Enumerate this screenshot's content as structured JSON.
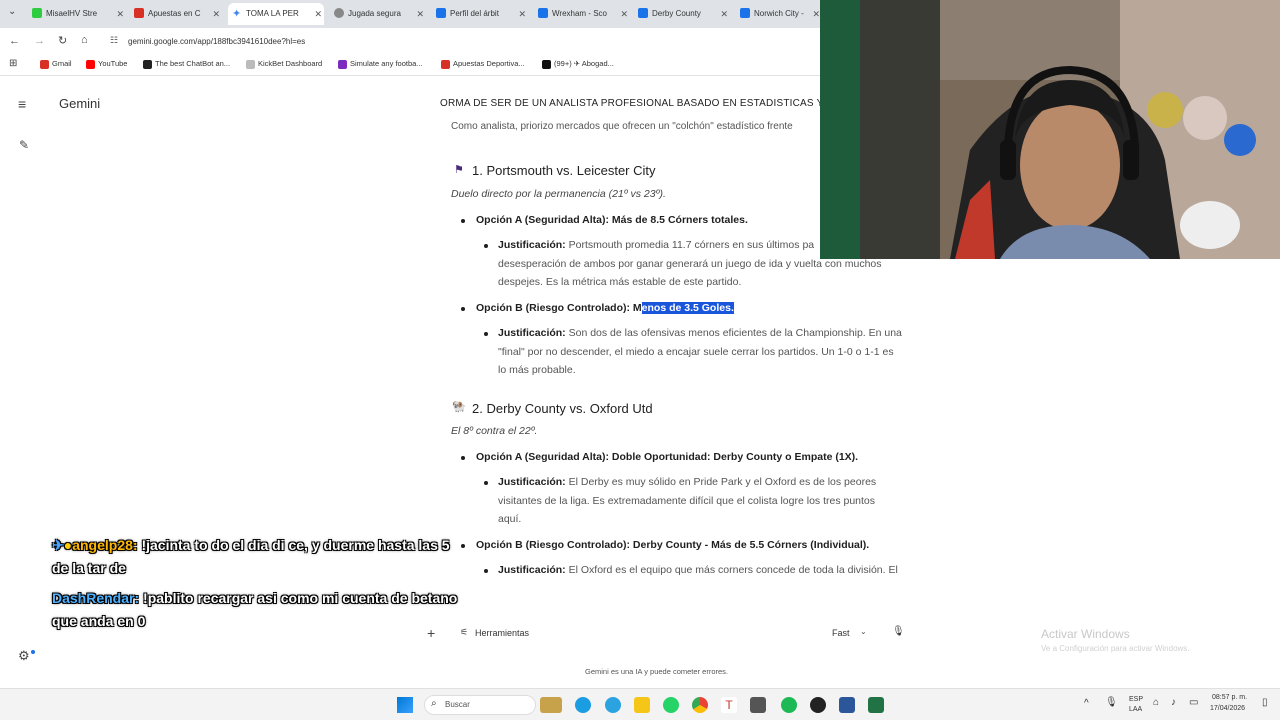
{
  "tabs": [
    {
      "label": "MisaelHV Stre",
      "color": "#2ecc40"
    },
    {
      "label": "Apuestas en C",
      "color": "#d93025"
    },
    {
      "label": "TOMA LA PER",
      "color": "#4285f4"
    },
    {
      "label": "Jugada segura",
      "color": "#777"
    },
    {
      "label": "Perfil del árbit",
      "color": "#1a73e8"
    },
    {
      "label": "Wrexham - Sco",
      "color": "#1a73e8"
    },
    {
      "label": "Derby County",
      "color": "#1a73e8"
    },
    {
      "label": "Norwich City -",
      "color": "#1a73e8"
    }
  ],
  "address": "gemini.google.com/app/188fbc3941610dee?hl=es",
  "bookmarks": [
    {
      "label": "Gmail",
      "color": "#d93025"
    },
    {
      "label": "YouTube",
      "color": "#ff0000"
    },
    {
      "label": "The best ChatBot an...",
      "color": "#222"
    },
    {
      "label": "KickBet Dashboard",
      "color": "#aaa"
    },
    {
      "label": "Simulate any footba...",
      "color": "#7b2cbf"
    },
    {
      "label": "Apuestas Deportiva...",
      "color": "#d93025"
    },
    {
      "label": "(99+) ✈ Abogad...",
      "color": "#111"
    }
  ],
  "gemini": {
    "title": "Gemini"
  },
  "doc": {
    "conv_title": "ORMA DE SER DE UN ANALISTA PROFESIONAL BASADO EN ESTADISTICAS Y",
    "intro": "Como analista, priorizo mercados que ofrecen un \"colchón\" estadístico frente",
    "m1": {
      "title": "1. Portsmouth vs. Leicester City",
      "sub": "Duelo directo por la permanencia (21º vs 23º).",
      "optA": "Opción A (Seguridad Alta): Más de 8.5 Córners totales.",
      "justA_label": "Justificación:",
      "justA_1": "Portsmouth promedia 11.7 córners en sus últimos pa",
      "justA_2": "desesperación de ambos por ganar generará un juego de ida y vuelta con muchos",
      "justA_3": "despejes. Es la métrica más estable de este partido.",
      "optB_pre": "Opción B (Riesgo Controlado): M",
      "optB_hl": "enos de 3.5 Goles.",
      "justB_label": "Justificación:",
      "justB_1": "Son dos de las ofensivas menos eficientes de la Championship. En una",
      "justB_2": "\"final\" por no descender, el miedo a encajar suele cerrar los partidos. Un 1-0 o 1-1 es",
      "justB_3": "lo más probable."
    },
    "m2": {
      "title": "2. Derby County vs. Oxford Utd",
      "sub": "El 8º contra el 22º.",
      "optA": "Opción A (Seguridad Alta): Doble Oportunidad: Derby County o Empate (1X).",
      "justA_label": "Justificación:",
      "justA_1": "El Derby es muy sólido en Pride Park y el Oxford es de los peores",
      "justA_2": "visitantes de la liga. Es extremadamente difícil que el colista logre los tres puntos",
      "justA_3": "aquí.",
      "optB": "Opción B (Riesgo Controlado): Derby County - Más de 5.5 Córners (Individual).",
      "justB_label": "Justificación:",
      "justB_1": "El Oxford es el equipo que más corners concede de toda la división. El"
    }
  },
  "input": {
    "tools": "Herramientas",
    "mode": "Fast",
    "disclaimer": "Gemini es una IA y puede cometer errores."
  },
  "chat": [
    {
      "user": "angelp28:",
      "msg": " !jacinta to do el dia di ce, y duerme hasta las 5",
      "msg2": "de la tar de",
      "color": "#ffb700"
    },
    {
      "user": "DashRendar:",
      "msg": " !pablito recargar asi como mi cuenta de betano",
      "msg2": "que anda en 0",
      "color": "#4db2ff"
    }
  ],
  "watermark": {
    "line1": "Activar Windows",
    "line2": "Ve a Configuración para activar Windows."
  },
  "taskbar": {
    "search": "Buscar",
    "lang1": "ESP",
    "lang2": "LAA",
    "time": "08:57 p. m.",
    "date": "17/04/2026"
  }
}
